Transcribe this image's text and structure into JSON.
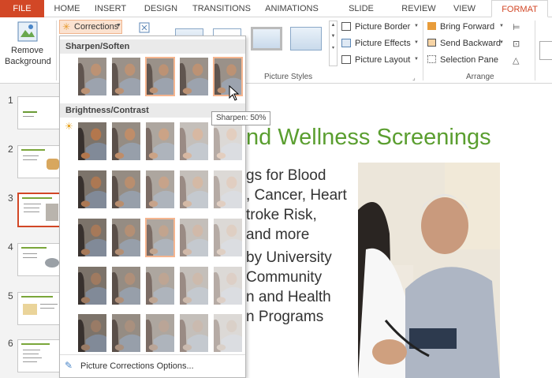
{
  "tabs": [
    "FILE",
    "HOME",
    "INSERT",
    "DESIGN",
    "TRANSITIONS",
    "ANIMATIONS",
    "SLIDE SHOW",
    "REVIEW",
    "VIEW",
    "FORMAT"
  ],
  "ribbon": {
    "remove_background": [
      "Remove",
      "Background"
    ],
    "corrections": "Corrections",
    "picture_styles_group": "Picture Styles",
    "arrange_group": "Arrange",
    "picture_border": "Picture Border",
    "picture_effects": "Picture Effects",
    "picture_layout": "Picture Layout",
    "bring_forward": "Bring Forward",
    "send_backward": "Send Backward",
    "selection_pane": "Selection Pane"
  },
  "dropdown": {
    "sharpen_header": "Sharpen/Soften",
    "brightness_header": "Brightness/Contrast",
    "options_link": "Picture Corrections Options...",
    "tooltip": "Sharpen: 50%"
  },
  "slide_numbers": [
    "1",
    "2",
    "3",
    "4",
    "5",
    "6"
  ],
  "slide": {
    "title": "nd Wellness Screenings",
    "body": [
      "gs for Blood",
      ", Cancer, Heart",
      "troke Risk,",
      " and more",
      " by University",
      "Community",
      "n and Health",
      "n Programs"
    ]
  },
  "colors": {
    "accent": "#d24726",
    "title_green": "#5a9e2f",
    "highlight": "#f5b58f"
  }
}
